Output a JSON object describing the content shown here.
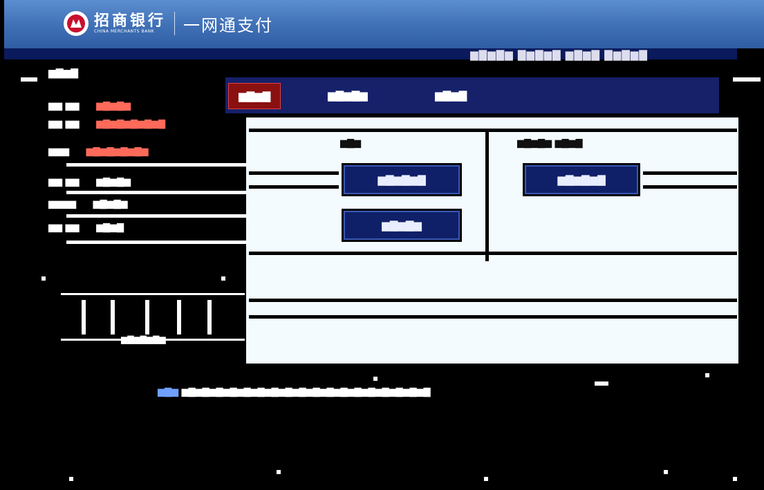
{
  "header": {
    "bank_cn": "招商银行",
    "bank_en": "CHINA MERCHANTS BANK",
    "product": "一网通支付",
    "top_right": "▆▇▆▇▆ ▇▆▇▆▇ ▆▇▆▇ ▇▆▇▆▇"
  },
  "order": {
    "title": "▆▇▆▇",
    "rows": [
      {
        "label": "▆▆ ▆▆",
        "value": "▆▇▆▇▆"
      },
      {
        "label": "▆▆ ▆▆",
        "value": "▆▇▆▇▆▇▆▇▆▇"
      },
      {
        "label": "▆▆▆",
        "value": "▆▇▆▇▆▇▆▇▆"
      },
      {
        "label": "▆▆ ▆▆",
        "value": "▆▇▆▇▆"
      },
      {
        "label": "▆▆▆▆",
        "value": "▆▇▆▇▆"
      },
      {
        "label": "▆▆ ▆▆",
        "value": "▆▇▆▇"
      }
    ],
    "card_caption": "▆▇▆▇▆▇▆"
  },
  "tabs": [
    {
      "label": "▆▇▆▇",
      "active": true
    },
    {
      "label": "▆▇▆▇▆",
      "active": false
    },
    {
      "label": "▆▇▆▇",
      "active": false
    }
  ],
  "options": {
    "left_label": "▆▇▆",
    "right_label": "▆▇▆▇▆ ▆▇▆▇",
    "btn1": "▆▇▆▇▆▇",
    "btn2": "▆▇▆▇▆▇",
    "btn3": "▆▇▆▇▆"
  },
  "footer": {
    "highlight": "▆▇▆",
    "text": "▆▇▆▇▆▇▆▇▆▇▆▇▆▇▆▇▆▇▆▇▆▇▆▇▆▇▆▇▆▇▆▇▆▇▆▇"
  },
  "colors": {
    "header_blue": "#3f6fb5",
    "tab_active": "#8b1010",
    "button_navy": "#0f2068",
    "panel_bg": "#f4fbff"
  }
}
